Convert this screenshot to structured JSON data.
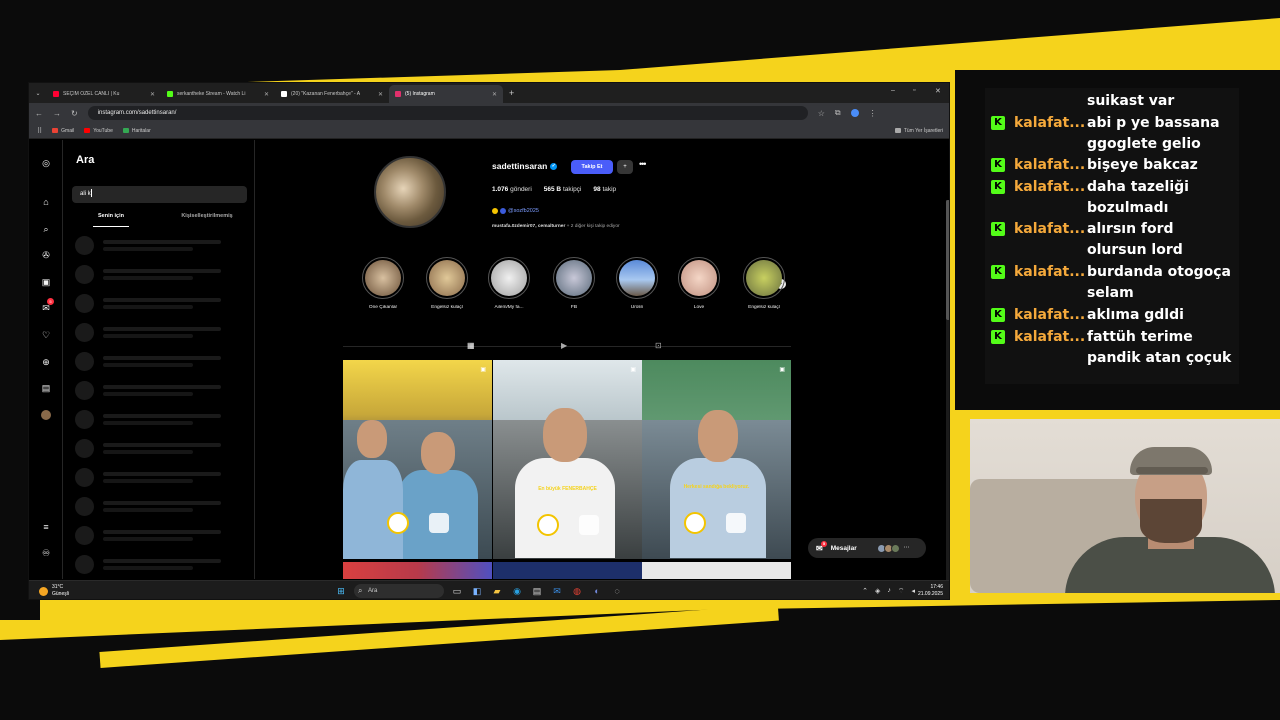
{
  "browser": {
    "tabs": [
      {
        "title": "SEÇİM ÖZEL CANLI | Ku",
        "fav": "#ff0033",
        "active": false
      },
      {
        "title": "serkantheke Stream - Watch Li",
        "fav": "#53fc18",
        "active": false
      },
      {
        "title": "(20) \"Kazanan Fenerbahçe\" - A",
        "fav": "#ffffff",
        "active": false
      },
      {
        "title": "(5) Instagram",
        "fav": "#e1306c",
        "active": true
      }
    ],
    "url": "instagram.com/sadettinsaran/",
    "bookmarks": [
      "Gmail",
      "YouTube",
      "Haritalar"
    ],
    "all_bookmarks": "Tüm Yer İşaretleri"
  },
  "search": {
    "title": "Ara",
    "query": "ali k",
    "tab_for_you": "Senin için",
    "tab_unpersonalized": "Kişiselleştirilmemiş"
  },
  "rail": {
    "notif_badge": "5"
  },
  "profile": {
    "username": "sadettinsaran",
    "follow_label": "Takip Et",
    "posts_count": "1.076",
    "posts_label": "gönderi",
    "followers_count": "565 B",
    "followers_label": "takipçi",
    "following_count": "98",
    "following_label": "takip",
    "threads_handle": "@sozfb2025",
    "followed_by_names": "mustafa.0zdemir07, cemalturner",
    "followed_by_rest": "+ 2 diğer kişi takip ediyor"
  },
  "highlights": [
    "Öne Çıkanlar",
    "Engelsiz kulaçl",
    "Ailem/My fa...",
    "FB",
    "Ürolin",
    "Love",
    "Engelsiz kulaçl"
  ],
  "posts": [
    {
      "caption": ""
    },
    {
      "caption": "En büyük FENERBAHÇE"
    },
    {
      "caption": "Herkesi sandığa bekliyoruz."
    }
  ],
  "messages": {
    "label": "Mesajlar",
    "badge": "5"
  },
  "taskbar": {
    "temp": "31°C",
    "weather": "Güneşli",
    "search": "Ara",
    "time": "17:46",
    "date": "21.09.2025"
  },
  "chat": [
    {
      "user": "",
      "message": "suikast var"
    },
    {
      "user": "kalafat...",
      "message": "abi p ye bassana ggoglete gelio"
    },
    {
      "user": "kalafat...",
      "message": "bişeye bakcaz"
    },
    {
      "user": "kalafat...",
      "message": "daha tazeliği bozulmadı"
    },
    {
      "user": "kalafat...",
      "message": "alırsın ford olursun lord"
    },
    {
      "user": "kalafat...",
      "message": "burdanda otogoça selam"
    },
    {
      "user": "kalafat...",
      "message": "aklıma gdldi"
    },
    {
      "user": "kalafat...",
      "message": "fattüh terime pandik atan çoçuk"
    }
  ],
  "colors": {
    "brand_yellow": "#f5d31c",
    "kick_green": "#53fc18",
    "ig_blue": "#4a5df9",
    "chat_user": "#f5a93b"
  }
}
